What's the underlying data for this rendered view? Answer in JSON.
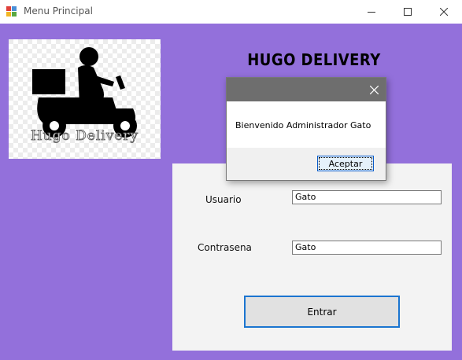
{
  "window": {
    "title": "Menu Principal",
    "icon": "winforms-app-icon",
    "controls": [
      "minimize-icon",
      "maximize-icon",
      "close-icon"
    ]
  },
  "main": {
    "heading": "HUGO DELIVERY",
    "logo_text": "Hugo Delivery",
    "background_color": "#9370DB"
  },
  "login": {
    "user_label": "Usuario",
    "user_value": "Gato",
    "password_label": "Contrasena",
    "password_value": "Gato",
    "enter_label": "Entrar"
  },
  "dialog": {
    "message": "Bienvenido Administrador Gato",
    "ok_label": "Aceptar"
  }
}
